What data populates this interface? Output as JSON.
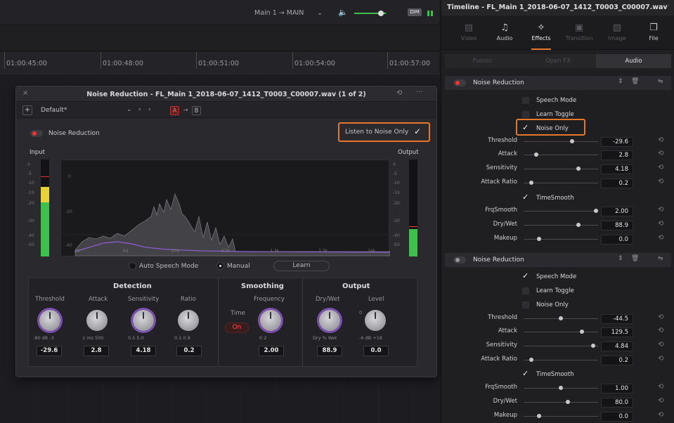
{
  "topbar": {
    "route": "Main 1  →  MAIN",
    "dim_label": "DIM"
  },
  "ruler": {
    "timecodes": [
      "01:00:45:00",
      "01:00:48:00",
      "01:00:51:00",
      "01:00:54:00",
      "01:00:57:00"
    ]
  },
  "plugin": {
    "title": "Noise Reduction - FL_Main 1_2018-06-07_1412_T0003_C00007.wav (1 of 2)",
    "preset": "Default*",
    "ab_a": "A",
    "ab_arrow": "→",
    "ab_b": "B",
    "enable_label": "Noise Reduction",
    "listen_label": "Listen to Noise Only",
    "input_label": "Input",
    "output_label": "Output",
    "meter_scale": [
      "0",
      "-5",
      "-10",
      "-15",
      "-20",
      "-30",
      "-40",
      "-50"
    ],
    "graph_y": [
      "0",
      "-20",
      "-40"
    ],
    "graph_x": [
      "20",
      "64",
      "208",
      "679",
      "2.2k",
      "7.2k",
      "24k"
    ],
    "mode_auto": "Auto Speech Mode",
    "mode_manual": "Manual",
    "learn_label": "Learn",
    "detection": {
      "title": "Detection",
      "threshold": {
        "label": "Threshold",
        "range": "-80  dB  -3",
        "value": "-29.6"
      },
      "attack": {
        "label": "Attack",
        "range": "1   ms  500",
        "value": "2.8"
      },
      "sensitivity": {
        "label": "Sensitivity",
        "range": "0.5      5.0",
        "value": "4.18"
      },
      "ratio": {
        "label": "Ratio",
        "range": "0.1      0.9",
        "value": "0.2"
      }
    },
    "smoothing": {
      "title": "Smoothing",
      "time_label": "Time",
      "time_state": "On",
      "frequency": {
        "label": "Frequency",
        "range": "0          2",
        "value": "2.00"
      }
    },
    "output": {
      "title": "Output",
      "drywet": {
        "label": "Dry/Wet",
        "range": "Dry  %  Wet",
        "value": "88.9"
      },
      "level": {
        "label": "Level",
        "range": "-6  dB  +18",
        "value": "0.0",
        "zero": "0"
      }
    }
  },
  "inspector": {
    "title": "Timeline - FL_Main 1_2018-06-07_1412_T0003_C00007.wav",
    "tabs": [
      {
        "label": "Video",
        "icon": "film-icon"
      },
      {
        "label": "Audio",
        "icon": "music-note-icon"
      },
      {
        "label": "Effects",
        "icon": "magic-wand-icon"
      },
      {
        "label": "Transition",
        "icon": "transition-icon"
      },
      {
        "label": "Image",
        "icon": "image-icon"
      },
      {
        "label": "File",
        "icon": "file-icon"
      }
    ],
    "subtabs": [
      "Fusion",
      "Open FX",
      "Audio"
    ],
    "panel1": {
      "title": "Noise Reduction",
      "speech_mode": "Speech Mode",
      "learn_toggle": "Learn Toggle",
      "noise_only": "Noise Only",
      "timesmooth": "TimeSmooth",
      "params": [
        {
          "label": "Threshold",
          "value": "-29.6",
          "level": 0.66
        },
        {
          "label": "Attack",
          "value": "2.8",
          "level": 0.15
        },
        {
          "label": "Sensitivity",
          "value": "4.18",
          "level": 0.75
        },
        {
          "label": "Attack Ratio",
          "value": "0.2",
          "level": 0.08
        },
        {
          "label": "FrqSmooth",
          "value": "2.00",
          "level": 1.0
        },
        {
          "label": "Dry/Wet",
          "value": "88.9",
          "level": 0.75
        },
        {
          "label": "Makeup",
          "value": "0.0",
          "level": 0.19
        }
      ]
    },
    "panel2": {
      "title": "Noise Reduction",
      "speech_mode": "Speech Mode",
      "learn_toggle": "Learn Toggle",
      "noise_only": "Noise Only",
      "timesmooth": "TimeSmooth",
      "params": [
        {
          "label": "Threshold",
          "value": "-44.5",
          "level": 0.5
        },
        {
          "label": "Attack",
          "value": "129.5",
          "level": 0.8
        },
        {
          "label": "Sensitivity",
          "value": "4.84",
          "level": 0.96
        },
        {
          "label": "Attack Ratio",
          "value": "0.2",
          "level": 0.08
        },
        {
          "label": "FrqSmooth",
          "value": "1.00",
          "level": 0.5
        },
        {
          "label": "Dry/Wet",
          "value": "80.0",
          "level": 0.6
        },
        {
          "label": "Makeup",
          "value": "0.0",
          "level": 0.19
        }
      ]
    }
  },
  "colors": {
    "accent": "#e8772e",
    "record_red": "#e33333",
    "knob_ring": "#7a4fb0",
    "meter_green": "#3fbf4b",
    "meter_yellow": "#e8d23a"
  }
}
